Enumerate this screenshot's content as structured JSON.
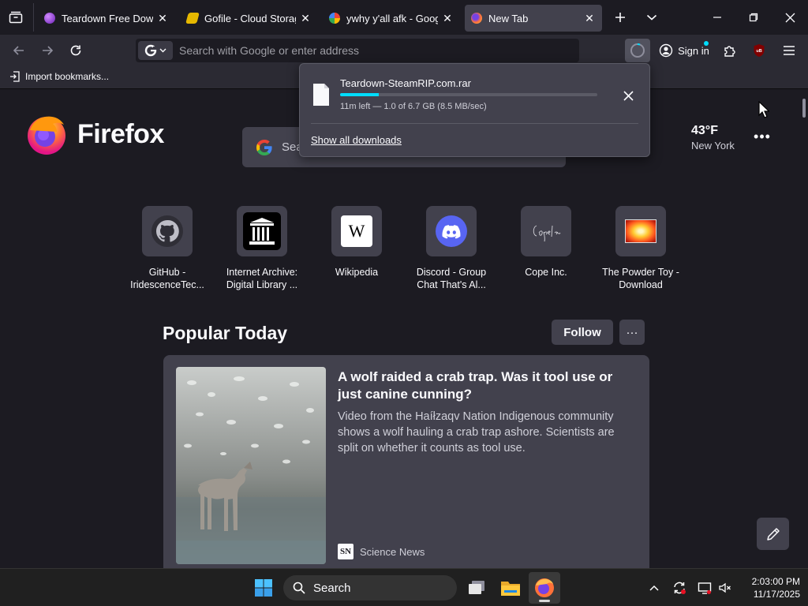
{
  "tabs": [
    {
      "title": "Teardown Free Downlo",
      "active": false,
      "favicon": "purple-orb-icon"
    },
    {
      "title": "Gofile - Cloud Storage",
      "active": false,
      "favicon": "gofile-icon"
    },
    {
      "title": "ywhy y'all afk - Google",
      "active": false,
      "favicon": "google-icon"
    },
    {
      "title": "New Tab",
      "active": true,
      "favicon": "firefox-icon"
    }
  ],
  "urlbar": {
    "placeholder": "Search with Google or enter address"
  },
  "signin": {
    "label": "Sign in"
  },
  "bookmarks": {
    "import_label": "Import bookmarks..."
  },
  "download": {
    "filename": "Teardown-SteamRIP.com.rar",
    "progress": 0.15,
    "status": "11m left — 1.0 of 6.7 GB (8.5 MB/sec)",
    "show_all": "Show all downloads"
  },
  "newtab": {
    "brand": "Firefox",
    "search_placeholder": "Search",
    "weather": {
      "temp": "43°F",
      "city": "New York"
    },
    "top_sites": [
      {
        "label_line1": "GitHub -",
        "label_line2": "IridescenceTec...",
        "icon": "github-icon"
      },
      {
        "label_line1": "Internet Archive:",
        "label_line2": "Digital Library ...",
        "icon": "archive-icon"
      },
      {
        "label_line1": "Wikipedia",
        "label_line2": "",
        "icon": "wikipedia-icon"
      },
      {
        "label_line1": "Discord - Group",
        "label_line2": "Chat That's Al...",
        "icon": "discord-icon"
      },
      {
        "label_line1": "Cope Inc.",
        "label_line2": "",
        "icon": "cope-signature-icon"
      },
      {
        "label_line1": "The Powder Toy -",
        "label_line2": "Download",
        "icon": "powder-toy-icon"
      }
    ],
    "popular": {
      "title": "Popular Today",
      "follow": "Follow",
      "more": "···",
      "story": {
        "title": "A wolf raided a crab trap. Was it tool use or just canine cunning?",
        "excerpt": "Video from the Haíłzaqv Nation Indigenous community shows a wolf hauling a crab trap ashore. Scientists are split on whether it counts as tool use.",
        "source": "Science News",
        "source_logo": "SN"
      }
    }
  },
  "taskbar": {
    "search_label": "Search",
    "time": "2:03:00 PM",
    "date": "11/17/2025"
  },
  "colors": {
    "accent": "#00ddff",
    "panel": "#42414d",
    "background": "#1c1b22",
    "toolbar": "#2b2a33"
  }
}
